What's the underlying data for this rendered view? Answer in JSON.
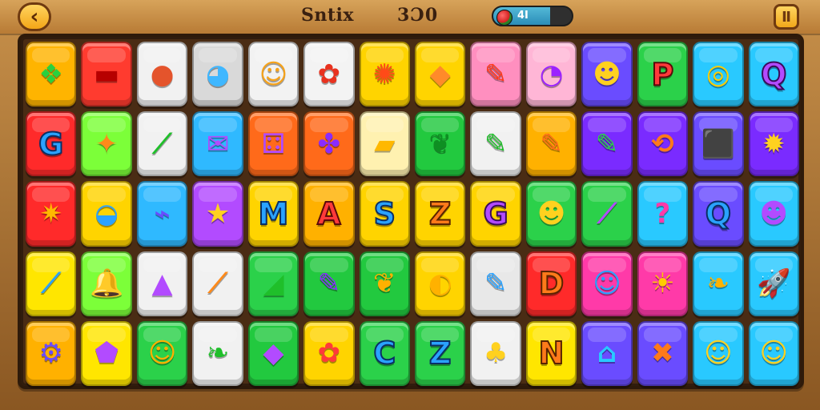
{
  "header": {
    "title": "Sntix",
    "score": "3Ɔ0",
    "progress_label": "4I",
    "progress_value": 0.72,
    "back_icon": "back-arrow-icon",
    "pause_icon": "pause-icon"
  },
  "board": {
    "rows": [
      [
        {
          "bg": "#ffb400",
          "icon": "leaf-icon",
          "glyph": "❖",
          "color": "#29d13f"
        },
        {
          "bg": "#ff3b2f",
          "icon": "rectangle-icon",
          "glyph": "▬",
          "color": "#b70000"
        },
        {
          "bg": "#f1f1f1",
          "icon": "cookie-icon",
          "glyph": "●",
          "color": "#e4542c"
        },
        {
          "bg": "#d9d9d9",
          "icon": "blue-ball-icon",
          "glyph": "◕",
          "color": "#3fb7ff"
        },
        {
          "bg": "#f2f2f2",
          "icon": "bear-icon",
          "glyph": "☺",
          "color": "#f5a21b"
        },
        {
          "bg": "#f3f3f3",
          "icon": "red-fruit-icon",
          "glyph": "✿",
          "color": "#e8321f"
        },
        {
          "bg": "#ffd400",
          "icon": "sun-icon",
          "glyph": "✺",
          "color": "#ff4b18"
        },
        {
          "bg": "#ffd400",
          "icon": "cake-icon",
          "glyph": "◆",
          "color": "#ff8a2a"
        },
        {
          "bg": "#ff8fbf",
          "icon": "pencil-icon",
          "glyph": "✎",
          "color": "#ff3a1a"
        },
        {
          "bg": "#ffb6d6",
          "icon": "purple-creature-icon",
          "glyph": "◔",
          "color": "#9b22ff"
        },
        {
          "bg": "#6a4cff",
          "icon": "smiley-icon",
          "glyph": "☻",
          "color": "#ffd11f"
        },
        {
          "bg": "#2bd14a",
          "icon": "letter-p-icon",
          "glyph": "P",
          "color": "#ff3a1a",
          "letter": true,
          "letter_class": "red"
        },
        {
          "bg": "#29c9ff",
          "icon": "ring-icon",
          "glyph": "◎",
          "color": "#ffcc00"
        },
        {
          "bg": "#29c9ff",
          "icon": "letter-q-icon",
          "glyph": "Q",
          "color": "#b24bff",
          "letter": true,
          "letter_class": "purple"
        }
      ],
      [
        {
          "bg": "#ff2a2a",
          "icon": "letter-g-icon",
          "glyph": "G",
          "color": "#2aa2ff",
          "letter": true,
          "letter_class": ""
        },
        {
          "bg": "#7cff39",
          "icon": "orange-fruit-icon",
          "glyph": "✦",
          "color": "#ff8a1a"
        },
        {
          "bg": "#f1f1f1",
          "icon": "green-crayon-icon",
          "glyph": "⟋",
          "color": "#1fbf2a"
        },
        {
          "bg": "#2fb9ff",
          "icon": "speech-bubble-icon",
          "glyph": "✉",
          "color": "#b24bff"
        },
        {
          "bg": "#ff6a1a",
          "icon": "dice-icon",
          "glyph": "⚃",
          "color": "#b24bff"
        },
        {
          "bg": "#ff6a1a",
          "icon": "swirl-icon",
          "glyph": "✤",
          "color": "#8a2bff"
        },
        {
          "bg": "#fff1b0",
          "icon": "yellow-block-icon",
          "glyph": "▰",
          "color": "#ffb800"
        },
        {
          "bg": "#22c93f",
          "icon": "green-leaf-icon",
          "glyph": "❦",
          "color": "#0e8f22"
        },
        {
          "bg": "#f1f1f1",
          "icon": "green-marker-icon",
          "glyph": "✎",
          "color": "#1fbf2a"
        },
        {
          "bg": "#ffb100",
          "icon": "orange-pencil-icon",
          "glyph": "✎",
          "color": "#ff6a1a"
        },
        {
          "bg": "#7a2bff",
          "icon": "green-pencil-icon",
          "glyph": "✎",
          "color": "#2bd14a"
        },
        {
          "bg": "#7a2bff",
          "icon": "boomerang-icon",
          "glyph": "⟲",
          "color": "#ff7a1a"
        },
        {
          "bg": "#6a4cff",
          "icon": "cube-icon",
          "glyph": "⬛",
          "color": "#2bd14a"
        },
        {
          "bg": "#7a2bff",
          "icon": "sunburst-icon",
          "glyph": "✹",
          "color": "#ffd11f"
        }
      ],
      [
        {
          "bg": "#ff2a2a",
          "icon": "orange-blob-icon",
          "glyph": "✷",
          "color": "#ffb800"
        },
        {
          "bg": "#ffd400",
          "icon": "blue-bell-icon",
          "glyph": "◒",
          "color": "#2aa2ff"
        },
        {
          "bg": "#2fb9ff",
          "icon": "tool-icon",
          "glyph": "⌁",
          "color": "#6a4cff"
        },
        {
          "bg": "#b24bff",
          "icon": "yellow-star-icon",
          "glyph": "★",
          "color": "#ffd11f"
        },
        {
          "bg": "#ffd400",
          "icon": "letter-m-icon",
          "glyph": "M",
          "color": "#2aa2ff",
          "letter": true,
          "letter_class": ""
        },
        {
          "bg": "#ffb100",
          "icon": "letter-a-icon",
          "glyph": "A",
          "color": "#ff3a3a",
          "letter": true,
          "letter_class": "red"
        },
        {
          "bg": "#ffd400",
          "icon": "letter-s-icon",
          "glyph": "S",
          "color": "#2aa2ff",
          "letter": true,
          "letter_class": ""
        },
        {
          "bg": "#ffd400",
          "icon": "letter-z-icon",
          "glyph": "Z",
          "color": "#ff7a1a",
          "letter": true,
          "letter_class": "orange"
        },
        {
          "bg": "#ffd400",
          "icon": "letter-g2-icon",
          "glyph": "G",
          "color": "#b24bff",
          "letter": true,
          "letter_class": "purple"
        },
        {
          "bg": "#2bd14a",
          "icon": "smiley-2-icon",
          "glyph": "☻",
          "color": "#ffd11f"
        },
        {
          "bg": "#2bd14a",
          "icon": "purple-stick-icon",
          "glyph": "⟋",
          "color": "#b24bff"
        },
        {
          "bg": "#29c9ff",
          "icon": "question-mark-icon",
          "glyph": "?",
          "color": "#ff3aa8"
        },
        {
          "bg": "#6a4cff",
          "icon": "letter-q2-icon",
          "glyph": "Q",
          "color": "#29c9ff",
          "letter": true,
          "letter_class": ""
        },
        {
          "bg": "#29c9ff",
          "icon": "purple-bear-icon",
          "glyph": "☻",
          "color": "#b24bff"
        }
      ],
      [
        {
          "bg": "#ffe600",
          "icon": "blue-crayon-icon",
          "glyph": "⟋",
          "color": "#2aa2ff"
        },
        {
          "bg": "#7cff39",
          "icon": "bell-icon",
          "glyph": "🔔",
          "color": "#ffb100"
        },
        {
          "bg": "#f1f1f1",
          "icon": "purple-cone-icon",
          "glyph": "▲",
          "color": "#b24bff"
        },
        {
          "bg": "#f1f1f1",
          "icon": "popsicle-icon",
          "glyph": "⟋",
          "color": "#ff8a1a"
        },
        {
          "bg": "#2bd14a",
          "icon": "green-shape-icon",
          "glyph": "◢",
          "color": "#1fbf2a"
        },
        {
          "bg": "#22c93f",
          "icon": "purple-marker-icon",
          "glyph": "✎",
          "color": "#8a2bff"
        },
        {
          "bg": "#22c93f",
          "icon": "orange-leaf-icon",
          "glyph": "❦",
          "color": "#ffb100"
        },
        {
          "bg": "#ffd400",
          "icon": "yellow-drop-icon",
          "glyph": "◐",
          "color": "#ffb100"
        },
        {
          "bg": "#e8e8e8",
          "icon": "blue-marker-icon",
          "glyph": "✎",
          "color": "#2aa2ff"
        },
        {
          "bg": "#ff2a2a",
          "icon": "letter-d-icon",
          "glyph": "D",
          "color": "#ff7a1a",
          "letter": true,
          "letter_class": "orange"
        },
        {
          "bg": "#ff3aa8",
          "icon": "blue-creature-icon",
          "glyph": "☺",
          "color": "#2aa2ff"
        },
        {
          "bg": "#ff3aa8",
          "icon": "sun-2-icon",
          "glyph": "☀",
          "color": "#ffcc00"
        },
        {
          "bg": "#29c9ff",
          "icon": "orange-feather-icon",
          "glyph": "❧",
          "color": "#ffb100"
        },
        {
          "bg": "#29c9ff",
          "icon": "rocket-icon",
          "glyph": "🚀",
          "color": "#ff3aa8"
        }
      ],
      [
        {
          "bg": "#ffb100",
          "icon": "gear-icon",
          "glyph": "⚙",
          "color": "#6a4cff"
        },
        {
          "bg": "#ffe600",
          "icon": "purple-cube-icon",
          "glyph": "⬟",
          "color": "#b24bff"
        },
        {
          "bg": "#2bd14a",
          "icon": "orange-creature-icon",
          "glyph": "☺",
          "color": "#ffb100"
        },
        {
          "bg": "#f1f1f1",
          "icon": "green-feather-icon",
          "glyph": "❧",
          "color": "#1fbf2a"
        },
        {
          "bg": "#22c93f",
          "icon": "purple-block-icon",
          "glyph": "◆",
          "color": "#b24bff"
        },
        {
          "bg": "#ffd400",
          "icon": "red-flower-icon",
          "glyph": "✿",
          "color": "#ff3a3a"
        },
        {
          "bg": "#2bd14a",
          "icon": "letter-c-icon",
          "glyph": "C",
          "color": "#2aa2ff",
          "letter": true,
          "letter_class": ""
        },
        {
          "bg": "#2bd14a",
          "icon": "letter-z2-icon",
          "glyph": "Z",
          "color": "#2aa2ff",
          "letter": true,
          "letter_class": ""
        },
        {
          "bg": "#f1f1f1",
          "icon": "yellow-chick-icon",
          "glyph": "♣",
          "color": "#ffd11f"
        },
        {
          "bg": "#ffe600",
          "icon": "letter-n-icon",
          "glyph": "N",
          "color": "#ff7a1a",
          "letter": true,
          "letter_class": "orange"
        },
        {
          "bg": "#6a4cff",
          "icon": "basket-icon",
          "glyph": "⌂",
          "color": "#29c9ff"
        },
        {
          "bg": "#6a4cff",
          "icon": "cross-icon",
          "glyph": "✖",
          "color": "#ff7a1a"
        },
        {
          "bg": "#29c9ff",
          "icon": "bear-2-icon",
          "glyph": "☺",
          "color": "#ffd11f"
        },
        {
          "bg": "#29c9ff",
          "icon": "yellow-face-icon",
          "glyph": "☺",
          "color": "#ffd11f"
        }
      ]
    ]
  }
}
